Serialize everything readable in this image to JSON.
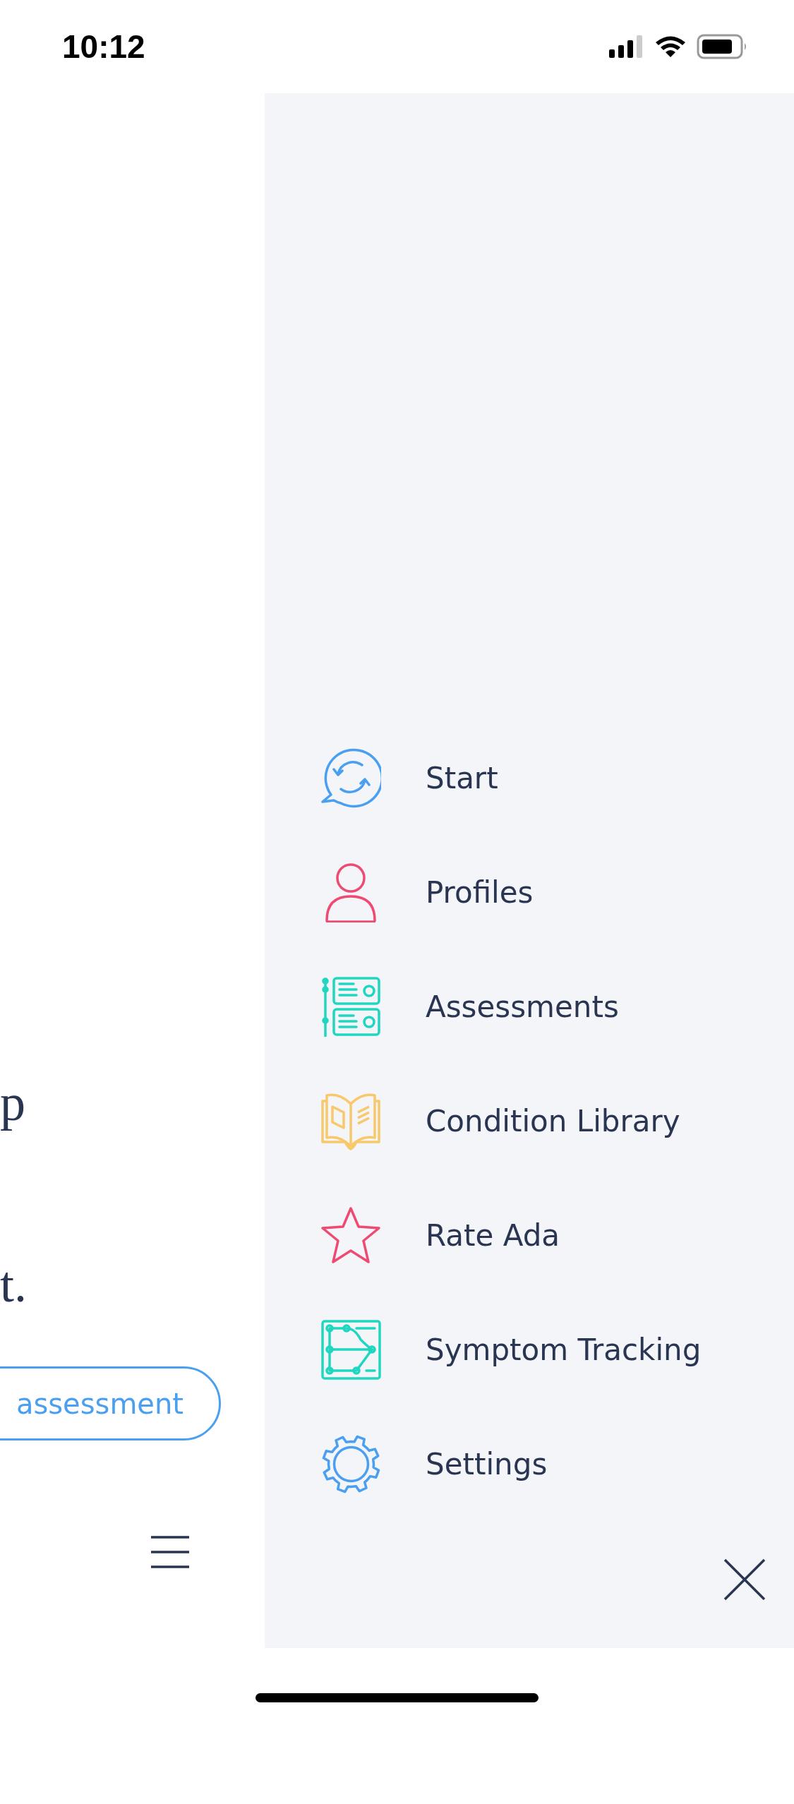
{
  "status_bar": {
    "time": "10:12"
  },
  "background": {
    "fragments": [
      "p",
      "t."
    ],
    "button": "assessment"
  },
  "menu": {
    "items": [
      {
        "label": "Start",
        "color": "#4a9ff0"
      },
      {
        "label": "Profiles",
        "color": "#ee4a72"
      },
      {
        "label": "Assessments",
        "color": "#1fd6c0"
      },
      {
        "label": "Condition Library",
        "color": "#f8c86a"
      },
      {
        "label": "Rate Ada",
        "color": "#ee4a72"
      },
      {
        "label": "Symptom Tracking",
        "color": "#1fd6c0"
      },
      {
        "label": "Settings",
        "color": "#4a9ff0"
      }
    ]
  }
}
